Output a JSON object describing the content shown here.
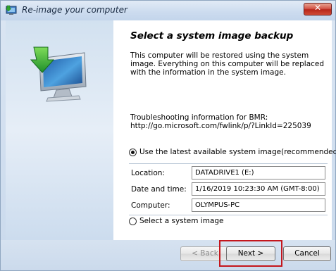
{
  "window": {
    "title": "Re-image your computer",
    "close_glyph": "✕"
  },
  "icons": {
    "app": "reimage-app-icon",
    "monitor": "monitor-restore-icon",
    "close": "close-icon"
  },
  "content": {
    "heading": "Select a system image backup",
    "description": "This computer will be restored using the system image. Everything on this computer will be replaced with the information in the system image.",
    "troubleshooting_label": "Troubleshooting information for BMR:",
    "troubleshooting_link": "http://go.microsoft.com/fwlink/p/?LinkId=225039"
  },
  "options": {
    "latest": {
      "label": "Use the latest available system image(recommended)",
      "selected": true
    },
    "select": {
      "label": "Select a system image",
      "selected": false
    }
  },
  "details": {
    "location_label": "Location:",
    "location_value": "DATADRIVE1 (E:)",
    "datetime_label": "Date and time:",
    "datetime_value": "1/16/2019 10:23:30 AM (GMT-8:00)",
    "computer_label": "Computer:",
    "computer_value": "OLYMPUS-PC"
  },
  "buttons": {
    "back": "< Back",
    "next": "Next >",
    "cancel": "Cancel"
  },
  "colors": {
    "highlight": "#c4161c",
    "close_button": "#c9372a",
    "chrome": "#cddcef"
  }
}
